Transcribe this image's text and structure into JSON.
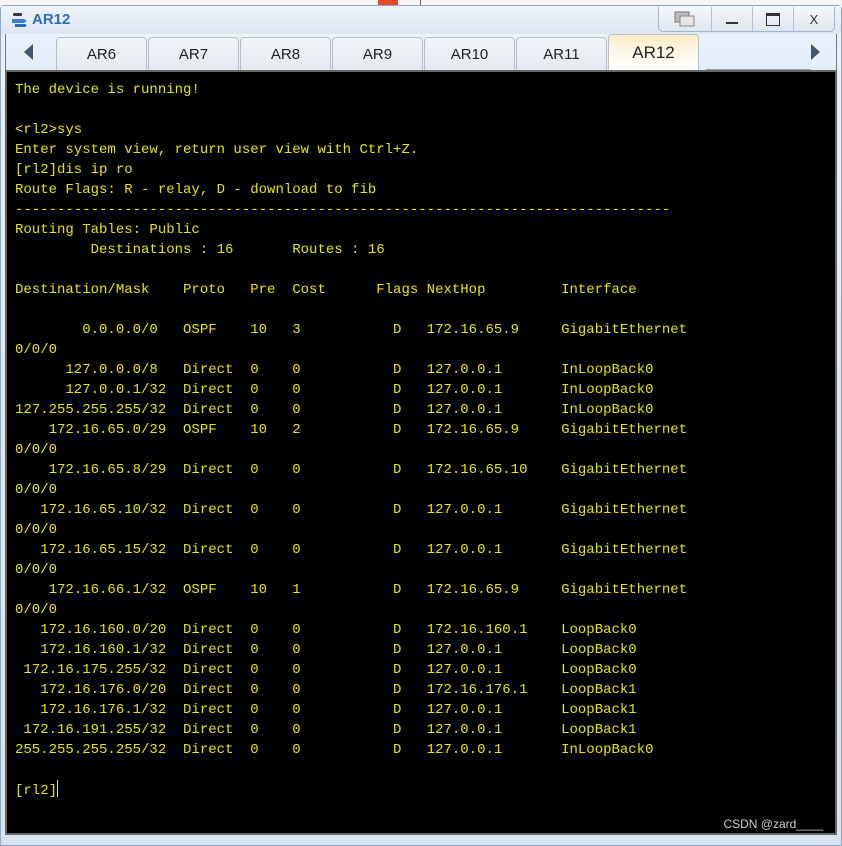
{
  "window": {
    "title": "AR12",
    "app_icon": "ensp-router-icon",
    "controls": [
      {
        "name": "restore-layout-button",
        "icon": "overlap-windows-icon",
        "glyph": "⧉"
      },
      {
        "name": "minimize-button",
        "icon": "minimize-icon",
        "glyph": "_"
      },
      {
        "name": "maximize-button",
        "icon": "maximize-icon",
        "glyph": "▭"
      },
      {
        "name": "close-button",
        "icon": "close-icon",
        "glyph": "X"
      }
    ]
  },
  "tabs": {
    "scroll_left_icon": "triangle-left-icon",
    "scroll_right_icon": "triangle-right-icon",
    "items": [
      {
        "label": "AR6",
        "active": false
      },
      {
        "label": "AR7",
        "active": false
      },
      {
        "label": "AR8",
        "active": false
      },
      {
        "label": "AR9",
        "active": false
      },
      {
        "label": "AR10",
        "active": false
      },
      {
        "label": "AR11",
        "active": false
      },
      {
        "label": "AR12",
        "active": true
      }
    ]
  },
  "terminal": {
    "text_color": "#e6e600",
    "background": "#000000",
    "lines": [
      "The device is running!",
      "",
      "<rl2>sys",
      "Enter system view, return user view with Ctrl+Z.",
      "[rl2]dis ip ro",
      "Route Flags: R - relay, D - download to fib",
      "------------------------------------------------------------------------------",
      "Routing Tables: Public",
      "         Destinations : 16       Routes : 16",
      "",
      "Destination/Mask    Proto   Pre  Cost      Flags NextHop         Interface",
      "",
      "        0.0.0.0/0   OSPF    10   3           D   172.16.65.9     GigabitEthernet",
      "0/0/0",
      "      127.0.0.0/8   Direct  0    0           D   127.0.0.1       InLoopBack0",
      "      127.0.0.1/32  Direct  0    0           D   127.0.0.1       InLoopBack0",
      "127.255.255.255/32  Direct  0    0           D   127.0.0.1       InLoopBack0",
      "    172.16.65.0/29  OSPF    10   2           D   172.16.65.9     GigabitEthernet",
      "0/0/0",
      "    172.16.65.8/29  Direct  0    0           D   172.16.65.10    GigabitEthernet",
      "0/0/0",
      "   172.16.65.10/32  Direct  0    0           D   127.0.0.1       GigabitEthernet",
      "0/0/0",
      "   172.16.65.15/32  Direct  0    0           D   127.0.0.1       GigabitEthernet",
      "0/0/0",
      "    172.16.66.1/32  OSPF    10   1           D   172.16.65.9     GigabitEthernet",
      "0/0/0",
      "   172.16.160.0/20  Direct  0    0           D   172.16.160.1    LoopBack0",
      "   172.16.160.1/32  Direct  0    0           D   127.0.0.1       LoopBack0",
      " 172.16.175.255/32  Direct  0    0           D   127.0.0.1       LoopBack0",
      "   172.16.176.0/20  Direct  0    0           D   172.16.176.1    LoopBack1",
      "   172.16.176.1/32  Direct  0    0           D   127.0.0.1       LoopBack1",
      " 172.16.191.255/32  Direct  0    0           D   127.0.0.1       LoopBack1",
      "255.255.255.255/32  Direct  0    0           D   127.0.0.1       InLoopBack0",
      ""
    ],
    "prompt": "[rl2]",
    "input_value": ""
  },
  "watermark": "CSDN @zard____"
}
